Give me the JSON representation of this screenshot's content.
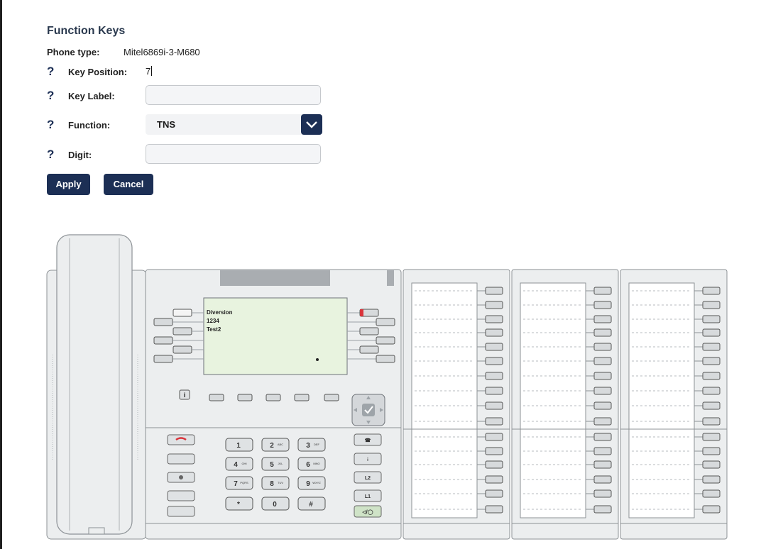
{
  "form": {
    "title": "Function Keys",
    "phone_type_label": "Phone type:",
    "phone_type_value": "Mitel6869i-3-M680",
    "help_icon": "?",
    "key_position_label": "Key Position:",
    "key_position_value": "7",
    "key_label_label": "Key Label:",
    "key_label_value": "",
    "function_label": "Function:",
    "function_value": "TNS",
    "digit_label": "Digit:",
    "digit_value": "",
    "apply_label": "Apply",
    "cancel_label": "Cancel"
  },
  "phone": {
    "screen_lines": [
      "Diversion",
      "1234",
      "Test2"
    ],
    "info_key": "i",
    "keypad": [
      {
        "digit": "1",
        "letters": ""
      },
      {
        "digit": "2",
        "letters": "ABC"
      },
      {
        "digit": "3",
        "letters": "DEF"
      },
      {
        "digit": "4",
        "letters": "GHI"
      },
      {
        "digit": "5",
        "letters": "JKL"
      },
      {
        "digit": "6",
        "letters": "MNO"
      },
      {
        "digit": "7",
        "letters": "PQRS"
      },
      {
        "digit": "8",
        "letters": "TUV"
      },
      {
        "digit": "9",
        "letters": "WXYZ"
      },
      {
        "digit": "*",
        "letters": ""
      },
      {
        "digit": "0",
        "letters": ""
      },
      {
        "digit": "#",
        "letters": ""
      }
    ],
    "right_keys": [
      "☎",
      "⁝",
      "L2",
      "L1",
      "◁/◯"
    ],
    "left_keys": [
      "hangup-icon",
      "transfer-icon",
      "settings-icon",
      "mute-icon",
      "volume-icon"
    ],
    "module_count": 3,
    "module_keys_per_column": 16
  },
  "colors": {
    "navy": "#1c2f55",
    "screen": "#e8f3df",
    "phone_body": "#eceeef",
    "red_key": "#d9343b"
  }
}
